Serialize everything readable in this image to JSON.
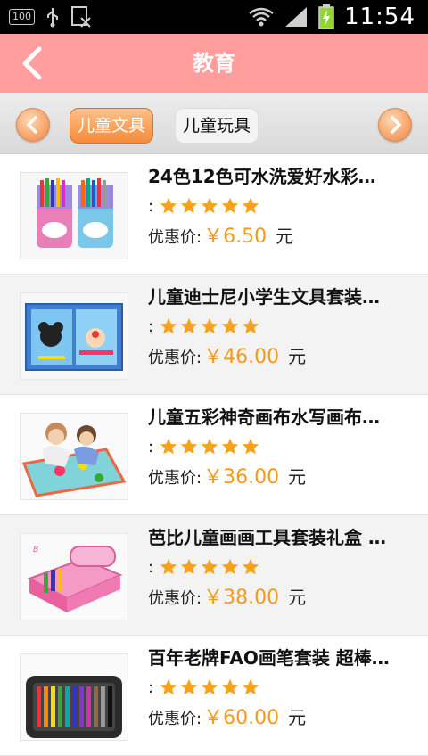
{
  "status_bar": {
    "badge": "100",
    "time": "11:54",
    "icons": [
      "usb-icon",
      "sim-icon",
      "wifi-icon",
      "signal-icon",
      "battery-icon"
    ]
  },
  "header": {
    "title": "教育",
    "back_icon": "back-arrow-icon",
    "background": "#ff9e9c"
  },
  "categories": {
    "tabs": [
      {
        "label": "儿童文具",
        "active": true
      },
      {
        "label": "儿童玩具",
        "active": false
      }
    ],
    "accent": "#f58a3a"
  },
  "products": [
    {
      "name": "24色12色可水洗爱好水彩…",
      "rating_prefix": ":",
      "stars": 5,
      "price_label": "优惠价:",
      "price": "￥6.50",
      "unit": "元"
    },
    {
      "name": "儿童迪士尼小学生文具套装…",
      "rating_prefix": ":",
      "stars": 5,
      "price_label": "优惠价:",
      "price": "￥46.00",
      "unit": "元"
    },
    {
      "name": "儿童五彩神奇画布水写画布…",
      "rating_prefix": ":",
      "stars": 5,
      "price_label": "优惠价:",
      "price": "￥36.00",
      "unit": "元"
    },
    {
      "name": "芭比儿童画画工具套装礼盒 …",
      "rating_prefix": ":",
      "stars": 5,
      "price_label": "优惠价:",
      "price": "￥38.00",
      "unit": "元"
    },
    {
      "name": "百年老牌FAO画笔套装 超棒…",
      "rating_prefix": ":",
      "stars": 5,
      "price_label": "优惠价:",
      "price": "￥60.00",
      "unit": "元"
    }
  ],
  "price_color": "#f39a1e"
}
